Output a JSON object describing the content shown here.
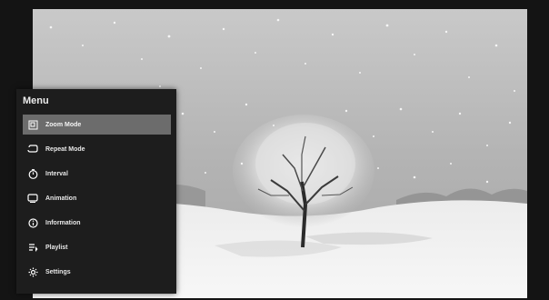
{
  "menu": {
    "title": "Menu",
    "items": [
      {
        "label": "Zoom Mode",
        "icon": "zoom-mode-icon",
        "selected": true
      },
      {
        "label": "Repeat Mode",
        "icon": "repeat-mode-icon",
        "selected": false
      },
      {
        "label": "Interval",
        "icon": "interval-timer-icon",
        "selected": false
      },
      {
        "label": "Animation",
        "icon": "animation-icon",
        "selected": false
      },
      {
        "label": "Information",
        "icon": "information-icon",
        "selected": false
      },
      {
        "label": "Playlist",
        "icon": "playlist-icon",
        "selected": false
      },
      {
        "label": "Settings",
        "icon": "settings-gear-icon",
        "selected": false
      }
    ]
  },
  "colors": {
    "menu_background": "#1d1d1d",
    "selected_highlight": "#6c6c6c",
    "menu_text": "#e8e8e8"
  }
}
